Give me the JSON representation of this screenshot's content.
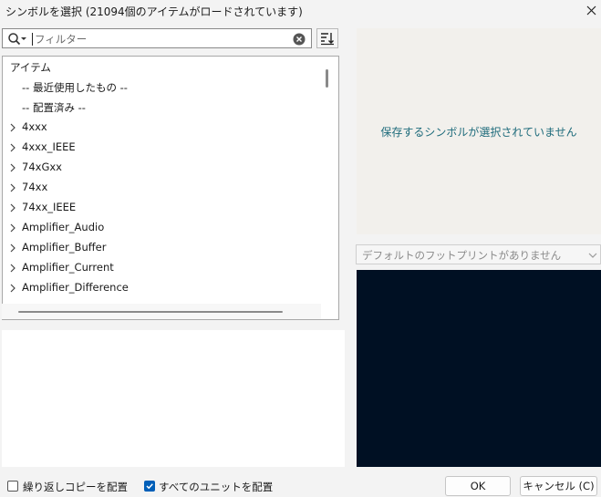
{
  "window": {
    "title": "シンボルを選択 (21094個のアイテムがロードされています)",
    "close_icon": "close-icon"
  },
  "filter": {
    "placeholder": "フィルター"
  },
  "tree": {
    "header": "アイテム",
    "rows": [
      {
        "label": "-- 最近使用したもの --",
        "expandable": false
      },
      {
        "label": "-- 配置済み --",
        "expandable": false
      },
      {
        "label": "4xxx",
        "expandable": true
      },
      {
        "label": "4xxx_IEEE",
        "expandable": true
      },
      {
        "label": "74xGxx",
        "expandable": true
      },
      {
        "label": "74xx",
        "expandable": true
      },
      {
        "label": "74xx_IEEE",
        "expandable": true
      },
      {
        "label": "Amplifier_Audio",
        "expandable": true
      },
      {
        "label": "Amplifier_Buffer",
        "expandable": true
      },
      {
        "label": "Amplifier_Current",
        "expandable": true
      },
      {
        "label": "Amplifier_Difference",
        "expandable": true
      }
    ]
  },
  "symbol_panel": {
    "message": "保存するシンボルが選択されていません"
  },
  "footprint": {
    "selected": "デフォルトのフットプリントがありません"
  },
  "footer": {
    "repeat_copy_label": "繰り返しコピーを配置",
    "repeat_copy_checked": false,
    "all_units_label": "すべてのユニットを配置",
    "all_units_checked": true,
    "ok_label": "OK",
    "cancel_label": "キャンセル (C)"
  },
  "colors": {
    "accent": "#005fb8",
    "message": "#1e6b7b",
    "footprint_bg": "#001023"
  }
}
